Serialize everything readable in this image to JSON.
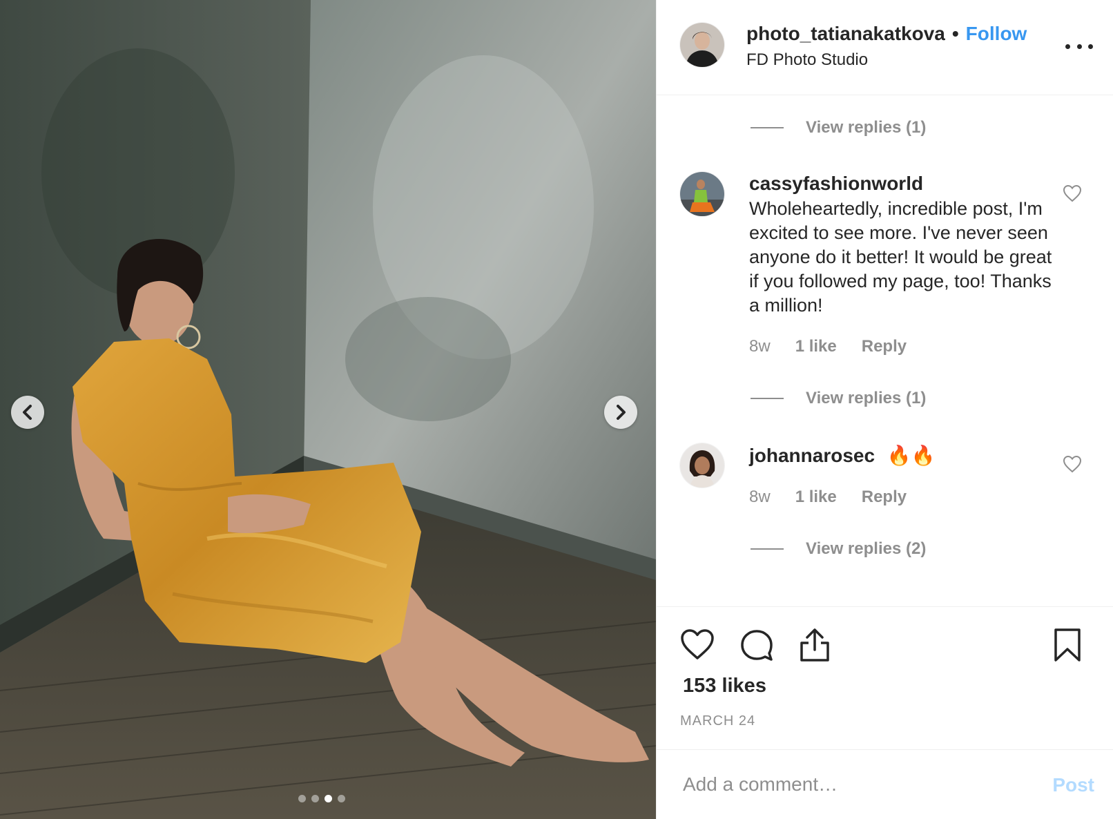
{
  "post": {
    "username": "photo_tatianakatkova",
    "separator": "•",
    "follow_label": "Follow",
    "location": "FD Photo Studio",
    "more_icon": "more-horizontal-icon"
  },
  "carousel": {
    "prev_icon": "chevron-left-icon",
    "next_icon": "chevron-right-icon",
    "total_images": 4,
    "active_index": 2
  },
  "comments": {
    "top_view_replies": "View replies (1)",
    "items": [
      {
        "username": "cassyfashionworld",
        "text": "Wholeheartedly, incredible post, I'm excited to see more. I've never seen anyone do it better! It would be great if you followed my page, too! Thanks a million!",
        "time": "8w",
        "likes": "1 like",
        "reply_label": "Reply",
        "view_replies": "View replies (1)"
      },
      {
        "username": "johannarosec",
        "text": "🔥🔥",
        "time": "8w",
        "likes": "1 like",
        "reply_label": "Reply",
        "view_replies": "View replies (2)"
      }
    ]
  },
  "actions": {
    "like_icon": "heart-icon",
    "comment_icon": "comment-icon",
    "share_icon": "share-icon",
    "save_icon": "bookmark-icon",
    "likes_count": "153 likes",
    "date": "MARCH 24"
  },
  "add_comment": {
    "placeholder": "Add a comment…",
    "post_label": "Post"
  },
  "colors": {
    "link_blue": "#3897f0",
    "post_disabled": "#b3dbff",
    "muted_text": "#8e8e8e"
  }
}
